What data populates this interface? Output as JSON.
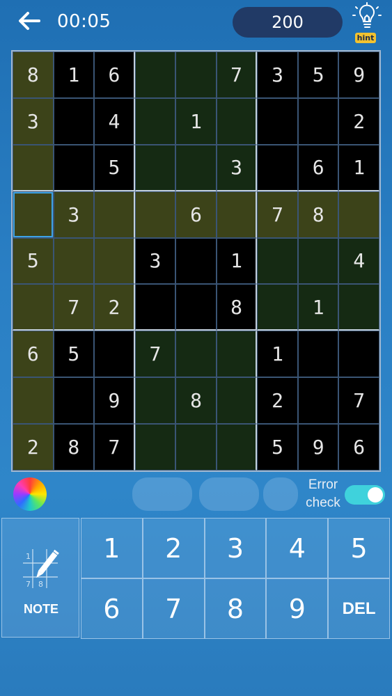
{
  "header": {
    "timer": "00:05",
    "score": "200",
    "hint_label": "hint"
  },
  "board": {
    "rows": [
      [
        "8",
        "1",
        "6",
        "",
        "",
        "7",
        "3",
        "5",
        "9"
      ],
      [
        "3",
        "",
        "4",
        "",
        "1",
        "",
        "",
        "",
        "2"
      ],
      [
        "",
        "",
        "5",
        "",
        "",
        "3",
        "",
        "6",
        "1"
      ],
      [
        "",
        "3",
        "",
        "",
        "6",
        "",
        "7",
        "8",
        ""
      ],
      [
        "5",
        "",
        "",
        "3",
        "",
        "1",
        "",
        "",
        "4"
      ],
      [
        "",
        "7",
        "2",
        "",
        "",
        "8",
        "",
        "1",
        ""
      ],
      [
        "6",
        "5",
        "",
        "7",
        "",
        "",
        "1",
        "",
        ""
      ],
      [
        "",
        "",
        "9",
        "",
        "8",
        "",
        "2",
        "",
        "7"
      ],
      [
        "2",
        "8",
        "7",
        "",
        "",
        "",
        "5",
        "9",
        "6"
      ]
    ],
    "shades": [
      [
        "olive",
        "black",
        "black",
        "dgreen",
        "dgreen",
        "dgreen",
        "black",
        "black",
        "black"
      ],
      [
        "olive",
        "black",
        "black",
        "dgreen",
        "dgreen",
        "dgreen",
        "black",
        "black",
        "black"
      ],
      [
        "olive",
        "black",
        "black",
        "dgreen",
        "dgreen",
        "dgreen",
        "black",
        "black",
        "black"
      ],
      [
        "olive",
        "olive",
        "olive",
        "olive",
        "olive",
        "olive",
        "olive",
        "olive",
        "olive"
      ],
      [
        "olive",
        "olive",
        "olive",
        "black",
        "black",
        "black",
        "dgreen",
        "dgreen",
        "dgreen"
      ],
      [
        "olive",
        "olive",
        "olive",
        "black",
        "black",
        "black",
        "dgreen",
        "dgreen",
        "dgreen"
      ],
      [
        "olive",
        "black",
        "black",
        "dgreen",
        "dgreen",
        "dgreen",
        "black",
        "black",
        "black"
      ],
      [
        "olive",
        "black",
        "black",
        "dgreen",
        "dgreen",
        "dgreen",
        "black",
        "black",
        "black"
      ],
      [
        "olive",
        "black",
        "black",
        "dgreen",
        "dgreen",
        "dgreen",
        "black",
        "black",
        "black"
      ]
    ],
    "selected": {
      "row": 3,
      "col": 0
    }
  },
  "controls": {
    "error_check_label": "Error check",
    "error_check_on": true,
    "note_label": "NOTE"
  },
  "keypad": {
    "keys": [
      "1",
      "2",
      "3",
      "4",
      "5",
      "6",
      "7",
      "8",
      "9",
      "DEL"
    ]
  },
  "colors": {
    "olive": "#3c4319",
    "dark_green": "#152a13",
    "black": "#000000",
    "toggle_on": "#3fd2dc",
    "score_pill": "#213a66",
    "hint_badge": "#f2c230"
  }
}
